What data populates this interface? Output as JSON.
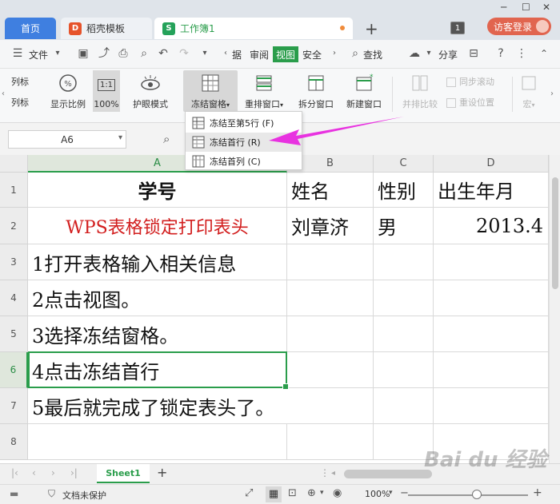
{
  "tabs": {
    "home": "首页",
    "template": "稻壳模板",
    "template_icon": "D",
    "doc": "工作簿1",
    "doc_icon": "S",
    "new_tab": "+",
    "num_badge": "1",
    "login": "访客登录"
  },
  "menubar": {
    "file": "文件",
    "items": [
      "据",
      "审阅",
      "视图",
      "安全"
    ],
    "search": "查找",
    "share": "分享"
  },
  "ribbon": {
    "col_list_1": "列标",
    "col_list_2": "列标",
    "show_ratio": "显示比例",
    "zoom_100": "100%",
    "eye_mode": "护眼模式",
    "freeze": "冻结窗格",
    "rearrange": "重排窗口",
    "split": "拆分窗口",
    "new_window": "新建窗口",
    "side_by_side": "并排比较",
    "sync_scroll": "同步滚动",
    "reset_pos": "重设位置",
    "macro": "宏",
    "one_to_one": "1:1"
  },
  "namebox": "A6",
  "freeze_menu": [
    {
      "label": "冻结至第5行 (F)"
    },
    {
      "label": "冻结首行 (R)"
    },
    {
      "label": "冻结首列 (C)"
    }
  ],
  "columns": [
    "A",
    "B",
    "C",
    "D"
  ],
  "rows": [
    "1",
    "2",
    "3",
    "4",
    "5",
    "6",
    "7",
    "8"
  ],
  "cells": {
    "r1": [
      "学号",
      "姓名",
      "性别",
      "出生年月"
    ],
    "r2": [
      "WPS表格锁定打印表头",
      "刘章济",
      "男",
      "2013.4"
    ],
    "r3": "1打开表格输入相关信息",
    "r4": "2点击视图。",
    "r5": "3选择冻结窗格。",
    "r6": "4点击冻结首行",
    "r7": "5最后就完成了锁定表头了。"
  },
  "sheet_tab": "Sheet1",
  "sheet_add": "+",
  "status": {
    "doc_unprotected": "文档未保护",
    "zoom": "100%"
  },
  "watermark": "Bai du 经验",
  "colors": {
    "accent_green": "#2a9d4b",
    "home_tab_blue": "#3f7fe0",
    "red_text": "#d21e1e",
    "arrow_magenta": "#e832e0"
  }
}
